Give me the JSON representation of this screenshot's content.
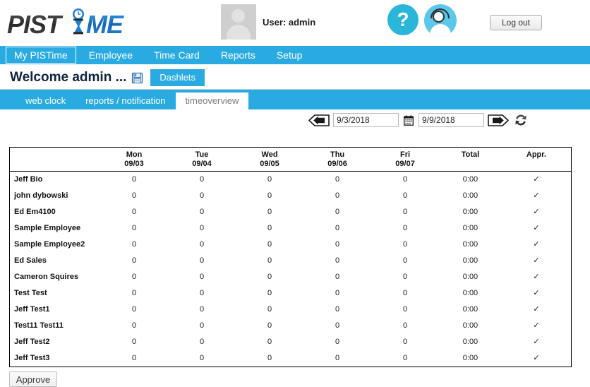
{
  "header": {
    "logo_text_dark": "PIST",
    "logo_text_light": "ME",
    "user_label": "User: admin",
    "help_glyph": "?",
    "logout_label": "Log out"
  },
  "mainnav": {
    "items": [
      {
        "label": "My PISTime",
        "active": true
      },
      {
        "label": "Employee",
        "active": false
      },
      {
        "label": "Time Card",
        "active": false
      },
      {
        "label": "Reports",
        "active": false
      },
      {
        "label": "Setup",
        "active": false
      }
    ]
  },
  "welcome": {
    "title": "Welcome admin ...",
    "dashlets_label": "Dashlets"
  },
  "subtabs": {
    "items": [
      {
        "label": "web clock",
        "active": false
      },
      {
        "label": "reports / notification",
        "active": false
      },
      {
        "label": "timeoverview",
        "active": true
      }
    ]
  },
  "datebar": {
    "start_date": "9/3/2018",
    "end_date": "9/9/2018",
    "start_placeholder": "9/3/2018",
    "end_placeholder": "9/9/2018"
  },
  "table": {
    "columns": [
      {
        "dow": "",
        "date": ""
      },
      {
        "dow": "Mon",
        "date": "09/03"
      },
      {
        "dow": "Tue",
        "date": "09/04"
      },
      {
        "dow": "Wed",
        "date": "09/05"
      },
      {
        "dow": "Thu",
        "date": "09/06"
      },
      {
        "dow": "Fri",
        "date": "09/07"
      },
      {
        "dow": "Total",
        "date": ""
      },
      {
        "dow": "Appr.",
        "date": ""
      }
    ],
    "rows": [
      {
        "name": "Jeff Bio",
        "mon": "0",
        "tue": "0",
        "wed": "0",
        "thu": "0",
        "fri": "0",
        "total": "0:00",
        "appr": "✓"
      },
      {
        "name": "john dybowski",
        "mon": "0",
        "tue": "0",
        "wed": "0",
        "thu": "0",
        "fri": "0",
        "total": "0:00",
        "appr": "✓"
      },
      {
        "name": "Ed Em4100",
        "mon": "0",
        "tue": "0",
        "wed": "0",
        "thu": "0",
        "fri": "0",
        "total": "0:00",
        "appr": "✓"
      },
      {
        "name": "Sample Employee",
        "mon": "0",
        "tue": "0",
        "wed": "0",
        "thu": "0",
        "fri": "0",
        "total": "0:00",
        "appr": "✓"
      },
      {
        "name": "Sample Employee2",
        "mon": "0",
        "tue": "0",
        "wed": "0",
        "thu": "0",
        "fri": "0",
        "total": "0:00",
        "appr": "✓"
      },
      {
        "name": "Ed Sales",
        "mon": "0",
        "tue": "0",
        "wed": "0",
        "thu": "0",
        "fri": "0",
        "total": "0:00",
        "appr": "✓"
      },
      {
        "name": "Cameron Squires",
        "mon": "0",
        "tue": "0",
        "wed": "0",
        "thu": "0",
        "fri": "0",
        "total": "0:00",
        "appr": "✓"
      },
      {
        "name": "Test Test",
        "mon": "0",
        "tue": "0",
        "wed": "0",
        "thu": "0",
        "fri": "0",
        "total": "0:00",
        "appr": "✓"
      },
      {
        "name": "Jeff Test1",
        "mon": "0",
        "tue": "0",
        "wed": "0",
        "thu": "0",
        "fri": "0",
        "total": "0:00",
        "appr": "✓"
      },
      {
        "name": "Test11 Test11",
        "mon": "0",
        "tue": "0",
        "wed": "0",
        "thu": "0",
        "fri": "0",
        "total": "0:00",
        "appr": "✓"
      },
      {
        "name": "Jeff Test2",
        "mon": "0",
        "tue": "0",
        "wed": "0",
        "thu": "0",
        "fri": "0",
        "total": "0:00",
        "appr": "✓"
      },
      {
        "name": "Jeff Test3",
        "mon": "0",
        "tue": "0",
        "wed": "0",
        "thu": "0",
        "fri": "0",
        "total": "0:00",
        "appr": "✓"
      }
    ]
  },
  "footer": {
    "approve_label": "Approve"
  },
  "colors": {
    "brand_blue": "#29ABE2",
    "help_cyan": "#29b6d8",
    "support_blue": "#5bc8ea",
    "logo_dark": "#3a3a3a",
    "logo_blue": "#1d7fd0"
  }
}
